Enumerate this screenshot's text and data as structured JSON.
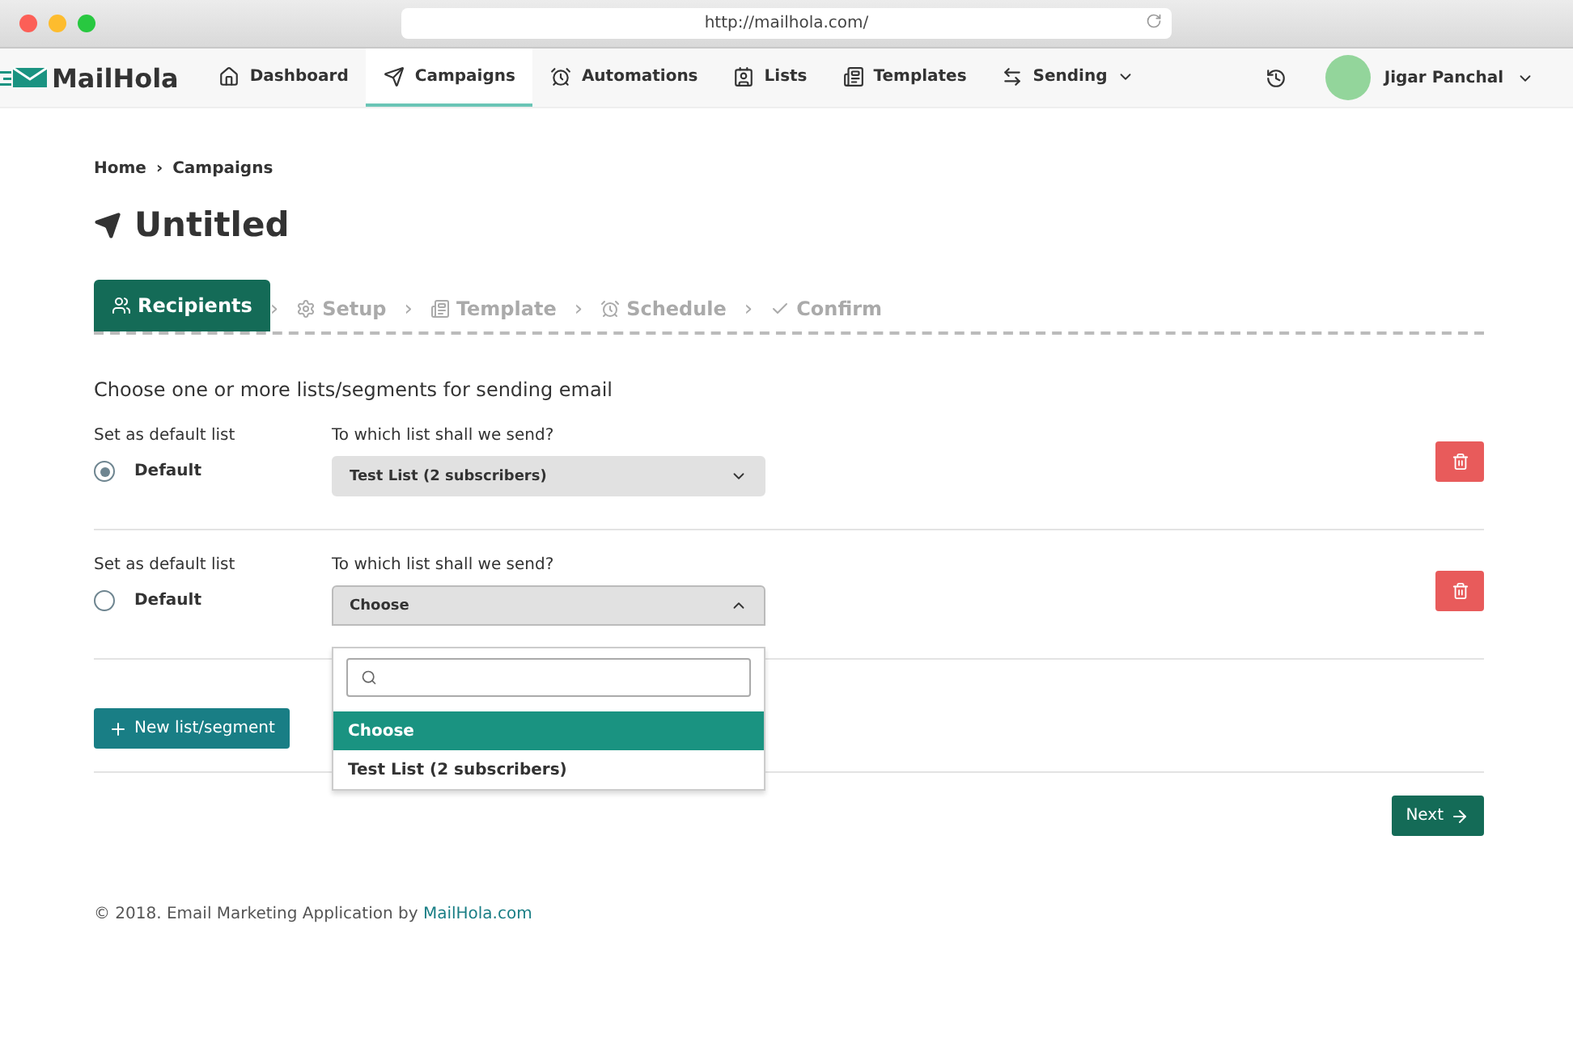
{
  "browser": {
    "url": "http://mailhola.com/"
  },
  "nav": {
    "brand": "MailHola",
    "items": [
      {
        "label": "Dashboard",
        "kind": "home",
        "selected": false,
        "menu": false
      },
      {
        "label": "Campaigns",
        "kind": "send",
        "selected": true,
        "menu": false
      },
      {
        "label": "Automations",
        "kind": "alarm",
        "selected": false,
        "menu": false
      },
      {
        "label": "Lists",
        "kind": "contacts",
        "selected": false,
        "menu": false
      },
      {
        "label": "Templates",
        "kind": "template",
        "selected": false,
        "menu": false
      },
      {
        "label": "Sending",
        "kind": "swap",
        "selected": false,
        "menu": true
      }
    ],
    "user": {
      "name": "Jigar Panchal"
    }
  },
  "breadcrumb": {
    "items": [
      "Home",
      "Campaigns"
    ],
    "separator": "›"
  },
  "title": "Untitled",
  "steps": {
    "separator": "›",
    "items": [
      {
        "label": "Recipients",
        "kind": "users",
        "selected": true
      },
      {
        "label": "Setup",
        "kind": "gear",
        "selected": false
      },
      {
        "label": "Template",
        "kind": "template",
        "selected": false
      },
      {
        "label": "Schedule",
        "kind": "alarm",
        "selected": false
      },
      {
        "label": "Confirm",
        "kind": "check",
        "selected": false
      }
    ]
  },
  "heading": "Choose one or more lists/segments for sending email",
  "rows": [
    {
      "default_heading": "Set as default list",
      "default_label": "Default",
      "checked": true,
      "list_heading": "To which list shall we send?",
      "value": "Test List (2 subscribers)",
      "expanded": false,
      "options": []
    },
    {
      "default_heading": "Set as default list",
      "default_label": "Default",
      "checked": false,
      "list_heading": "To which list shall we send?",
      "value": "Choose",
      "expanded": true,
      "options": [
        {
          "label": "Choose",
          "selected": true
        },
        {
          "label": "Test List (2 subscribers)",
          "selected": false
        }
      ]
    }
  ],
  "new_button": "New list/segment",
  "next_button": "Next",
  "footer": {
    "text": "© 2018. Email Marketing Application by",
    "link": "MailHola.com"
  }
}
